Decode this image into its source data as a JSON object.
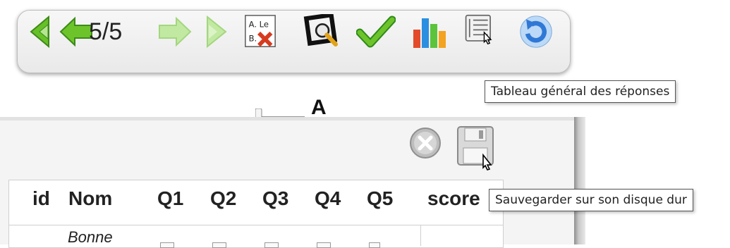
{
  "toolbar": {
    "counter": "5/5",
    "buttons": {
      "first": "first-page-icon",
      "previous": "previous-page-icon",
      "next": "next-page-icon",
      "last": "last-page-icon",
      "answers_toggle": "answer-options-icon",
      "zoom": "zoom-icon",
      "validate": "checkmark-icon",
      "chart": "bar-chart-icon",
      "table": "answers-table-icon",
      "refresh": "refresh-icon"
    },
    "answers_icon_lines": [
      "A. Le",
      "B."
    ],
    "tooltip": "Tableau général des réponses"
  },
  "fragment": {
    "letter": "A"
  },
  "panel": {
    "close_icon": "close-circle-icon",
    "save_icon": "floppy-disk-icon",
    "save_tooltip": "Sauvegarder sur son disque dur",
    "table": {
      "headers": [
        "id",
        "Nom",
        "Q1",
        "Q2",
        "Q3",
        "Q4",
        "Q5",
        "score"
      ],
      "first_row_name": "Bonne"
    }
  },
  "colors": {
    "green": "#6cc42a",
    "light_green": "#c2e9a1",
    "blue": "#2f78d6"
  }
}
